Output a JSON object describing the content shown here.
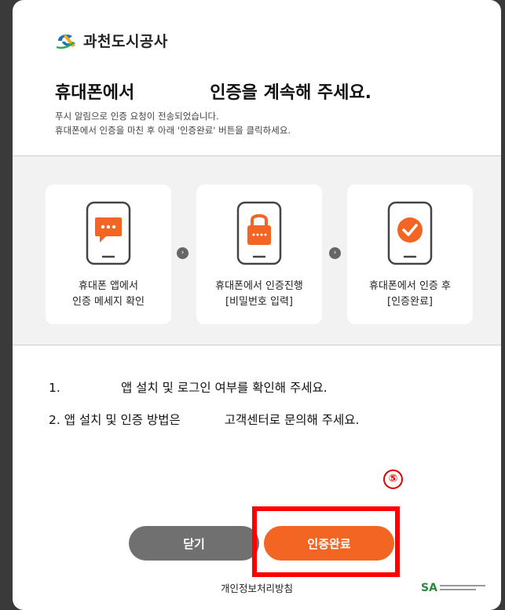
{
  "brand": {
    "name": "과천도시공사"
  },
  "header": {
    "title_prefix": "휴대폰에서",
    "title_suffix": "인증을 계속해 주세요.",
    "sub1": "푸시 알림으로 인증 요청이 전송되었습니다.",
    "sub2": "휴대폰에서 인증을 마친 후 아래 '인증완료' 버튼을 클릭하세요."
  },
  "steps": [
    {
      "icon": "chat-bubble-icon",
      "line1": "휴대폰 앱에서",
      "line2": "인증 메세지 확인"
    },
    {
      "icon": "lock-icon",
      "line1": "휴대폰에서 인증진행",
      "line2": "[비밀번호 입력]"
    },
    {
      "icon": "check-circle-icon",
      "line1": "휴대폰에서 인증 후",
      "line2": "[인증완료]"
    }
  ],
  "notes": {
    "n1_num": "1.",
    "n1_text": "앱 설치 및 로그인 여부를 확인해 주세요.",
    "n2_prefix": "2. 앱 설치 및 인증 방법은",
    "n2_suffix": "고객센터로 문의해 주세요."
  },
  "annotation": {
    "marker": "⑤"
  },
  "buttons": {
    "close_label": "닫기",
    "done_label": "인증완료"
  },
  "footer": {
    "privacy_label": "개인정보처리방침",
    "sa_mark": "SA"
  },
  "colors": {
    "accent": "#f26522",
    "close_button": "#707070",
    "annotation": "#ff0000"
  }
}
